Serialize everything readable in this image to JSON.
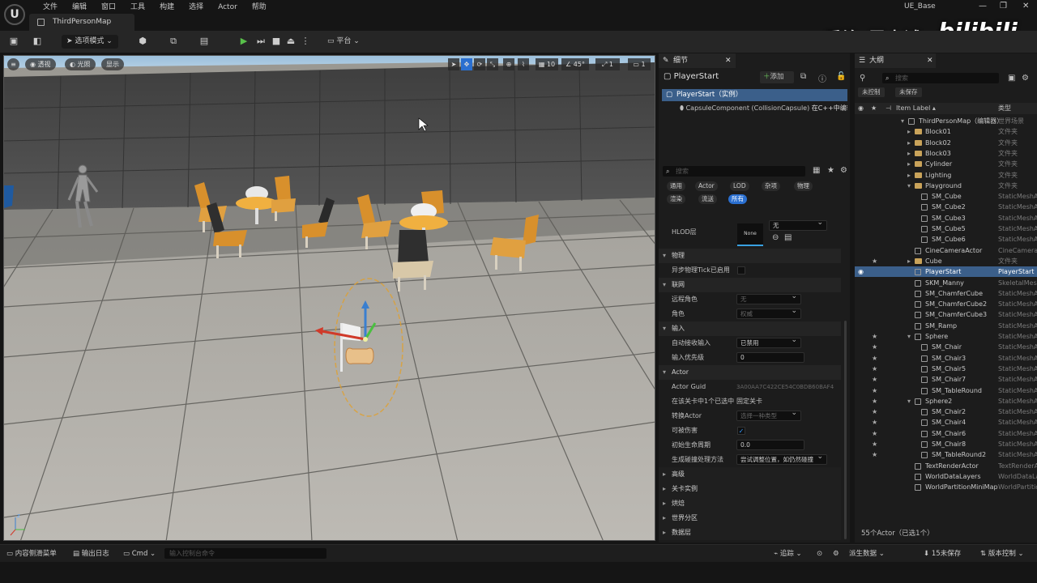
{
  "app": {
    "logo_text": "U",
    "project": "UE_Base",
    "map_tab": "ThirdPersonMap"
  },
  "menu": [
    "文件",
    "编辑",
    "窗口",
    "工具",
    "构建",
    "选择",
    "Actor",
    "帮助"
  ],
  "watermark": {
    "text": "乔治-周士诚",
    "logo": "bilibili"
  },
  "toolbar": {
    "select_mode": "选项模式",
    "platform": "平台"
  },
  "viewport": {
    "perspective": "透视",
    "lighting": "光照",
    "show": "显示",
    "grid_size": "10",
    "angle": "45°",
    "scale": "1",
    "camera_speed": "1"
  },
  "details": {
    "tab": "细节",
    "actor_name": "PlayerStart",
    "add": "添加",
    "component_root": "PlayerStart（实例）",
    "component_child": "CapsuleComponent (CollisionCapsule)",
    "component_child_note": "在C++中编辑",
    "search_placeholder": "搜索",
    "filters": [
      "通用",
      "Actor",
      "LOD",
      "杂项",
      "物理",
      "渲染",
      "流送",
      "所有"
    ],
    "hlod": {
      "label": "HLOD层",
      "thumb": "None",
      "value": "无"
    },
    "physics": {
      "title": "物理",
      "async_tick": "异步物理Tick已启用"
    },
    "network": {
      "title": "联网",
      "remote_role": "远程角色",
      "remote_role_value": "无",
      "role": "角色",
      "role_value": "权威"
    },
    "input": {
      "title": "输入",
      "auto_receive": "自动接收输入",
      "auto_receive_value": "已禁用",
      "priority": "输入优先级",
      "priority_value": "0"
    },
    "actor": {
      "title": "Actor",
      "guid_label": "Actor Guid",
      "guid": "3A00AA7C422CE54C0BDB60BAF4",
      "level_label": "在该关卡中1个已选中",
      "level_value": "固定关卡",
      "convert_label": "转换Actor",
      "convert_value": "选择一种类型",
      "damage_label": "可被伤害",
      "lifespan_label": "初始生命周期",
      "lifespan_value": "0.0",
      "spawn_label": "生成碰撞处理方法",
      "spawn_value": "尝试调整位置，如仍然碰撞"
    },
    "collapsed": [
      "高级",
      "关卡实例",
      "烘焙",
      "世界分区",
      "数据层"
    ]
  },
  "outliner": {
    "tab": "大纲",
    "search_placeholder": "搜索",
    "tags": [
      "未控制",
      "未保存"
    ],
    "col_label": "Item Label",
    "col_type": "类型",
    "rows": [
      {
        "name": "ThirdPersonMap（编辑器）",
        "type": "世界场景",
        "indent": 0,
        "kind": "map",
        "star": false
      },
      {
        "name": "Block01",
        "type": "文件夹",
        "indent": 1,
        "kind": "folder",
        "star": false
      },
      {
        "name": "Block02",
        "type": "文件夹",
        "indent": 1,
        "kind": "folder",
        "star": false
      },
      {
        "name": "Block03",
        "type": "文件夹",
        "indent": 1,
        "kind": "folder",
        "star": false
      },
      {
        "name": "Cylinder",
        "type": "文件夹",
        "indent": 1,
        "kind": "folder",
        "star": false
      },
      {
        "name": "Lighting",
        "type": "文件夹",
        "indent": 1,
        "kind": "folder",
        "star": false
      },
      {
        "name": "Playground",
        "type": "文件夹",
        "indent": 1,
        "kind": "folder",
        "star": false
      },
      {
        "name": "SM_Cube",
        "type": "StaticMeshActor",
        "indent": 2,
        "kind": "mesh",
        "star": false
      },
      {
        "name": "SM_Cube2",
        "type": "StaticMeshActor",
        "indent": 2,
        "kind": "mesh",
        "star": false
      },
      {
        "name": "SM_Cube3",
        "type": "StaticMeshActor",
        "indent": 2,
        "kind": "mesh",
        "star": false
      },
      {
        "name": "SM_Cube5",
        "type": "StaticMeshActor",
        "indent": 2,
        "kind": "mesh",
        "star": false
      },
      {
        "name": "SM_Cube6",
        "type": "StaticMeshActor",
        "indent": 2,
        "kind": "mesh",
        "star": false
      },
      {
        "name": "CineCameraActor",
        "type": "CineCameraActor",
        "indent": 1,
        "kind": "actor",
        "star": false
      },
      {
        "name": "Cube",
        "type": "文件夹",
        "indent": 1,
        "kind": "folder",
        "star": true
      },
      {
        "name": "PlayerStart",
        "type": "PlayerStart",
        "indent": 1,
        "kind": "actor",
        "star": false,
        "selected": true
      },
      {
        "name": "SKM_Manny",
        "type": "SkeletalMeshActor",
        "indent": 1,
        "kind": "actor",
        "star": false
      },
      {
        "name": "SM_ChamferCube",
        "type": "StaticMeshActor",
        "indent": 1,
        "kind": "actor",
        "star": false
      },
      {
        "name": "SM_ChamferCube2",
        "type": "StaticMeshActor",
        "indent": 1,
        "kind": "actor",
        "star": false
      },
      {
        "name": "SM_ChamferCube3",
        "type": "StaticMeshActor",
        "indent": 1,
        "kind": "actor",
        "star": false
      },
      {
        "name": "SM_Ramp",
        "type": "StaticMeshActor",
        "indent": 1,
        "kind": "actor",
        "star": false
      },
      {
        "name": "Sphere",
        "type": "StaticMeshActor",
        "indent": 1,
        "kind": "mesh",
        "star": true
      },
      {
        "name": "SM_Chair",
        "type": "StaticMeshActor",
        "indent": 2,
        "kind": "mesh",
        "star": true
      },
      {
        "name": "SM_Chair3",
        "type": "StaticMeshActor",
        "indent": 2,
        "kind": "mesh",
        "star": true
      },
      {
        "name": "SM_Chair5",
        "type": "StaticMeshActor",
        "indent": 2,
        "kind": "mesh",
        "star": true
      },
      {
        "name": "SM_Chair7",
        "type": "StaticMeshActor",
        "indent": 2,
        "kind": "mesh",
        "star": true
      },
      {
        "name": "SM_TableRound",
        "type": "StaticMeshActor",
        "indent": 2,
        "kind": "mesh",
        "star": true
      },
      {
        "name": "Sphere2",
        "type": "StaticMeshActor",
        "indent": 1,
        "kind": "mesh",
        "star": true
      },
      {
        "name": "SM_Chair2",
        "type": "StaticMeshActor",
        "indent": 2,
        "kind": "mesh",
        "star": true
      },
      {
        "name": "SM_Chair4",
        "type": "StaticMeshActor",
        "indent": 2,
        "kind": "mesh",
        "star": true
      },
      {
        "name": "SM_Chair6",
        "type": "StaticMeshActor",
        "indent": 2,
        "kind": "mesh",
        "star": true
      },
      {
        "name": "SM_Chair8",
        "type": "StaticMeshActor",
        "indent": 2,
        "kind": "mesh",
        "star": true
      },
      {
        "name": "SM_TableRound2",
        "type": "StaticMeshActor",
        "indent": 2,
        "kind": "mesh",
        "star": true
      },
      {
        "name": "TextRenderActor",
        "type": "TextRenderActor",
        "indent": 1,
        "kind": "actor",
        "star": false
      },
      {
        "name": "WorldDataLayers",
        "type": "WorldDataLayers",
        "indent": 1,
        "kind": "actor",
        "star": false
      },
      {
        "name": "WorldPartitionMiniMap",
        "type": "WorldPartitionMiniMap",
        "indent": 1,
        "kind": "actor",
        "star": false
      }
    ],
    "footer": "55个Actor（已选1个）"
  },
  "status": {
    "content_drawer": "内容侧滑菜单",
    "output_log": "输出日志",
    "cmd": "Cmd",
    "cmd_placeholder": "输入控制台命令",
    "trace": "追踪",
    "derived_data": "派生数据",
    "unsaved": "15未保存",
    "source_control": "版本控制"
  }
}
